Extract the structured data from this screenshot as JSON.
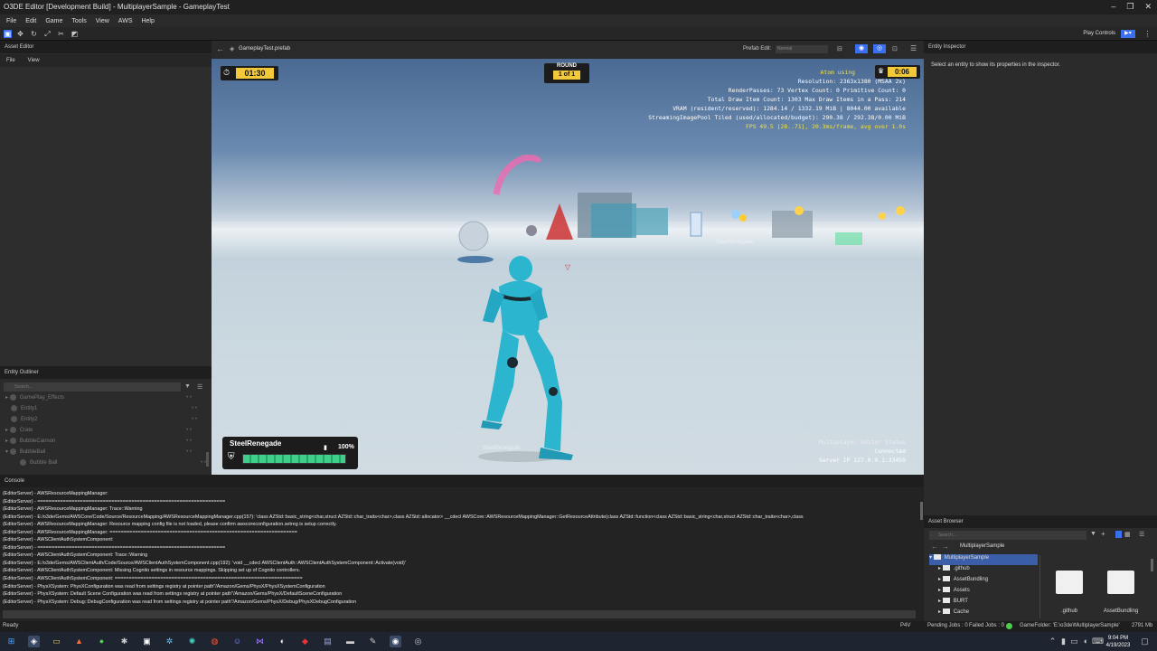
{
  "window": {
    "title": "O3DE Editor [Development Build] - MultiplayerSample - GameplayTest",
    "minimize_glyph": "–",
    "maximize_glyph": "❐",
    "close_glyph": "✕"
  },
  "menu": [
    "File",
    "Edit",
    "Game",
    "Tools",
    "View",
    "AWS",
    "Help"
  ],
  "toolbar": {
    "play_controls_label": "Play Controls",
    "play_glyph": "▶▾"
  },
  "asset_editor": {
    "title": "Asset Editor",
    "menu": [
      "File",
      "View"
    ]
  },
  "entity_outliner": {
    "title": "Entity Outliner",
    "search_placeholder": "Search...",
    "entities": [
      {
        "name": "GamePlay_Effects",
        "expander": "▸"
      },
      {
        "name": "Entity1",
        "expander": ""
      },
      {
        "name": "Entity2",
        "expander": ""
      },
      {
        "name": "Crate",
        "expander": "▸"
      },
      {
        "name": "BubbleCannon",
        "expander": "▸"
      },
      {
        "name": "BubbleBall",
        "expander": "▾"
      },
      {
        "name": "Bubble Ball",
        "expander": ""
      }
    ]
  },
  "viewport": {
    "breadcrumb": "GameplayTest.prefab",
    "prefab_edit_label": "Prefab Edit:",
    "prefab_edit_value": "Normal",
    "hud": {
      "timer": "01:30",
      "round_label": "ROUND",
      "round_value": "1 of 1",
      "clock": "0:06",
      "player_name": "SteelRenegade",
      "health_text": "100%",
      "health": 1.0
    },
    "stats": [
      "Atom using",
      "Resolution: 2363x1380 (MSAA 2x)",
      "RenderPasses: 73 Vertex Count: 0 Primitive Count: 0",
      "Total Draw Item Count: 1303  Max Draw Items in a Pass: 214",
      "VRAM (resident/reserved): 1284.14 / 1332.19 MiB | 8044.00 available",
      "StreamingImagePool Tiled (used/allocated/budget): 290.38 / 292.38/0.00 MiB",
      "FPS 49.5 [28..71], 20.3ms/frame, avg over 1.0s"
    ],
    "server_info": [
      "Multiplayer Editor Status",
      "Connected",
      "Server IP 127.0.0.1:33450"
    ],
    "nametags": [
      "SteelRenegade",
      "SteelRenegade"
    ]
  },
  "inspector": {
    "title": "Entity Inspector",
    "hint": "Select an entity to show its properties in the inspector."
  },
  "console": {
    "title": "Console",
    "lines": [
      "(EditorServer) - AWSResourceMappingManager:",
      "(EditorServer) - ==================================================================",
      "(EditorServer) - AWSResourceMappingManager: Trace::Warning",
      "(EditorServer) -  E:/o3de/Gems/AWSCore/Code/Source/ResourceMapping/AWSResourceMappingManager.cpp(157): 'class AZStd::basic_string<char,struct AZStd::char_traits<char>,class AZStd::allocator> __cdecl AWSCore::AWSResourceMappingManager::GetResourceAttribute(class AZStd::function<class AZStd::basic_string<char,struct AZStd::char_traits<char>,class",
      "(EditorServer) - AWSResourceMappingManager: Resource mapping config file is not loaded, please confirm awscoreconfiguration.setreg is setup correctly.",
      "(EditorServer) - AWSResourceMappingManager: ==================================================================",
      "(EditorServer) - AWSClientAuthSystemComponent:",
      "(EditorServer) - ==================================================================",
      "(EditorServer) - AWSClientAuthSystemComponent: Trace::Warning",
      "(EditorServer) -  E:/o3de/Gems/AWSClientAuth/Code/Source/AWSClientAuthSystemComponent.cpp(192): 'void __cdecl AWSClientAuth::AWSClientAuthSystemComponent::Activate(void)'",
      "(EditorServer) - AWSClientAuthSystemComponent: Missing Cognito settings in resource mappings. Skipping set up of Cognito controllers.",
      "(EditorServer) - AWSClientAuthSystemComponent: ==================================================================",
      "(EditorServer) - PhysXSystem: PhysXConfiguration was read from settings registry at pointer path\"/Amazon/Gems/PhysX/PhysXSystemConfiguration",
      "(EditorServer) - PhysXSystem: Default Scene Configuration was read from settings registry at pointer path\"/Amazon/Gems/PhysX/DefaultSceneConfiguration",
      "(EditorServer) - PhysXSystem: Debug::DebugConfiguration was read from settings registry at pointer path\"/Amazon/Gems/PhysX/Debug/PhysXDebugConfiguration"
    ]
  },
  "asset_browser": {
    "title": "Asset Browser",
    "search_placeholder": "Search...",
    "path": "MultiplayerSample",
    "tree": [
      {
        "name": "MultiplayerSample",
        "expander": "▾"
      },
      {
        "name": ".github",
        "expander": "▸"
      },
      {
        "name": "AssetBundling",
        "expander": "▸"
      },
      {
        "name": "Assets",
        "expander": "▸"
      },
      {
        "name": "BURT",
        "expander": "▸"
      },
      {
        "name": "Cache",
        "expander": "▸"
      }
    ],
    "tiles": [
      ".github",
      "AssetBundling"
    ]
  },
  "status": {
    "ready": "Ready",
    "p4v": "P4V",
    "pending_jobs": "Pending Jobs : 0",
    "failed_jobs": "Failed Jobs : 0",
    "game_folder": "GameFolder: 'E:\\o3de\\MultiplayerSample'",
    "memory": "2791 Mb"
  },
  "taskbar": {
    "time": "9:04 PM",
    "date": "4/19/2023"
  },
  "colors": {
    "accent": "#3a6ff0",
    "hud_yellow": "#f3c93a",
    "health_green": "#3ed08a",
    "stats_yellow": "#f0e040",
    "character_cyan": "#2bb5cf"
  }
}
